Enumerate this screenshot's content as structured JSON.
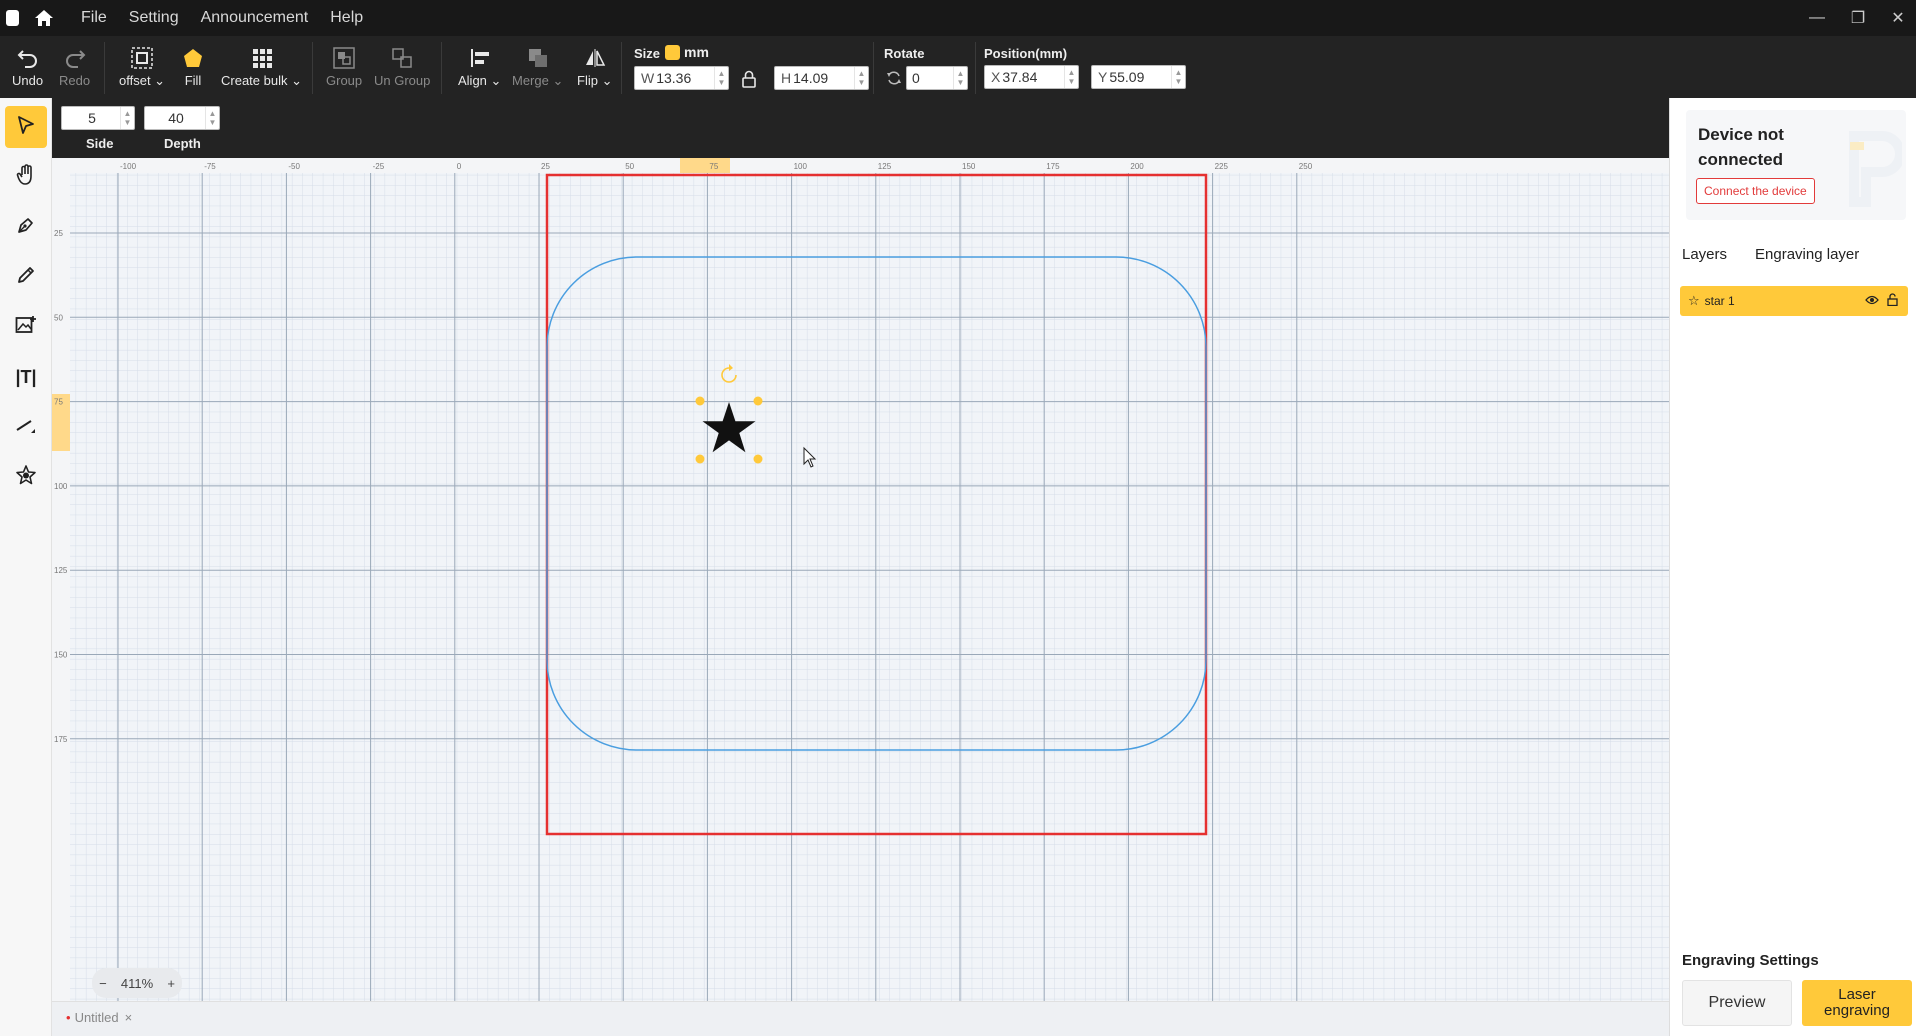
{
  "menu": {
    "file": "File",
    "setting": "Setting",
    "announcement": "Announcement",
    "help": "Help"
  },
  "toolbar": {
    "undo": "Undo",
    "redo": "Redo",
    "offset": "offset",
    "fill": "Fill",
    "create_bulk": "Create bulk",
    "group": "Group",
    "ungroup": "Un Group",
    "align": "Align",
    "merge": "Merge",
    "flip": "Flip",
    "size_label": "Size",
    "unit": "mm",
    "width_prefix": "W",
    "width": "13.36",
    "height_prefix": "H",
    "height": "14.09",
    "rotate_label": "Rotate",
    "rotate": "0",
    "position_label": "Position(mm)",
    "x_prefix": "X",
    "x": "37.84",
    "y_prefix": "Y",
    "y": "55.09"
  },
  "subbar": {
    "side_value": "5",
    "side_label": "Side",
    "depth_value": "40",
    "depth_label": "Depth"
  },
  "ruler": {
    "top_ticks": [
      "-100",
      "-75",
      "-50",
      "-25",
      "0",
      "25",
      "50",
      "75",
      "100",
      "125",
      "150",
      "175",
      "200",
      "225",
      "250"
    ],
    "left_ticks": [
      "25",
      "50",
      "75",
      "100",
      "125",
      "150",
      "175"
    ]
  },
  "right_panel": {
    "device_status": "Device not connected",
    "connect_button": "Connect the device",
    "tab_layers": "Layers",
    "tab_engraving": "Engraving layer",
    "layer_name": "star 1",
    "engraving_settings": "Engraving Settings",
    "preview": "Preview",
    "laser_engraving": "Laser engraving"
  },
  "zoom": {
    "minus": "−",
    "value": "411%",
    "plus": "+"
  },
  "document": {
    "tab_name": "Untitled",
    "modified_mark": "•",
    "close": "×"
  },
  "colors": {
    "accent": "#ffc93a",
    "work_area": "#e53030",
    "shape_outline": "#4a9ee0"
  }
}
